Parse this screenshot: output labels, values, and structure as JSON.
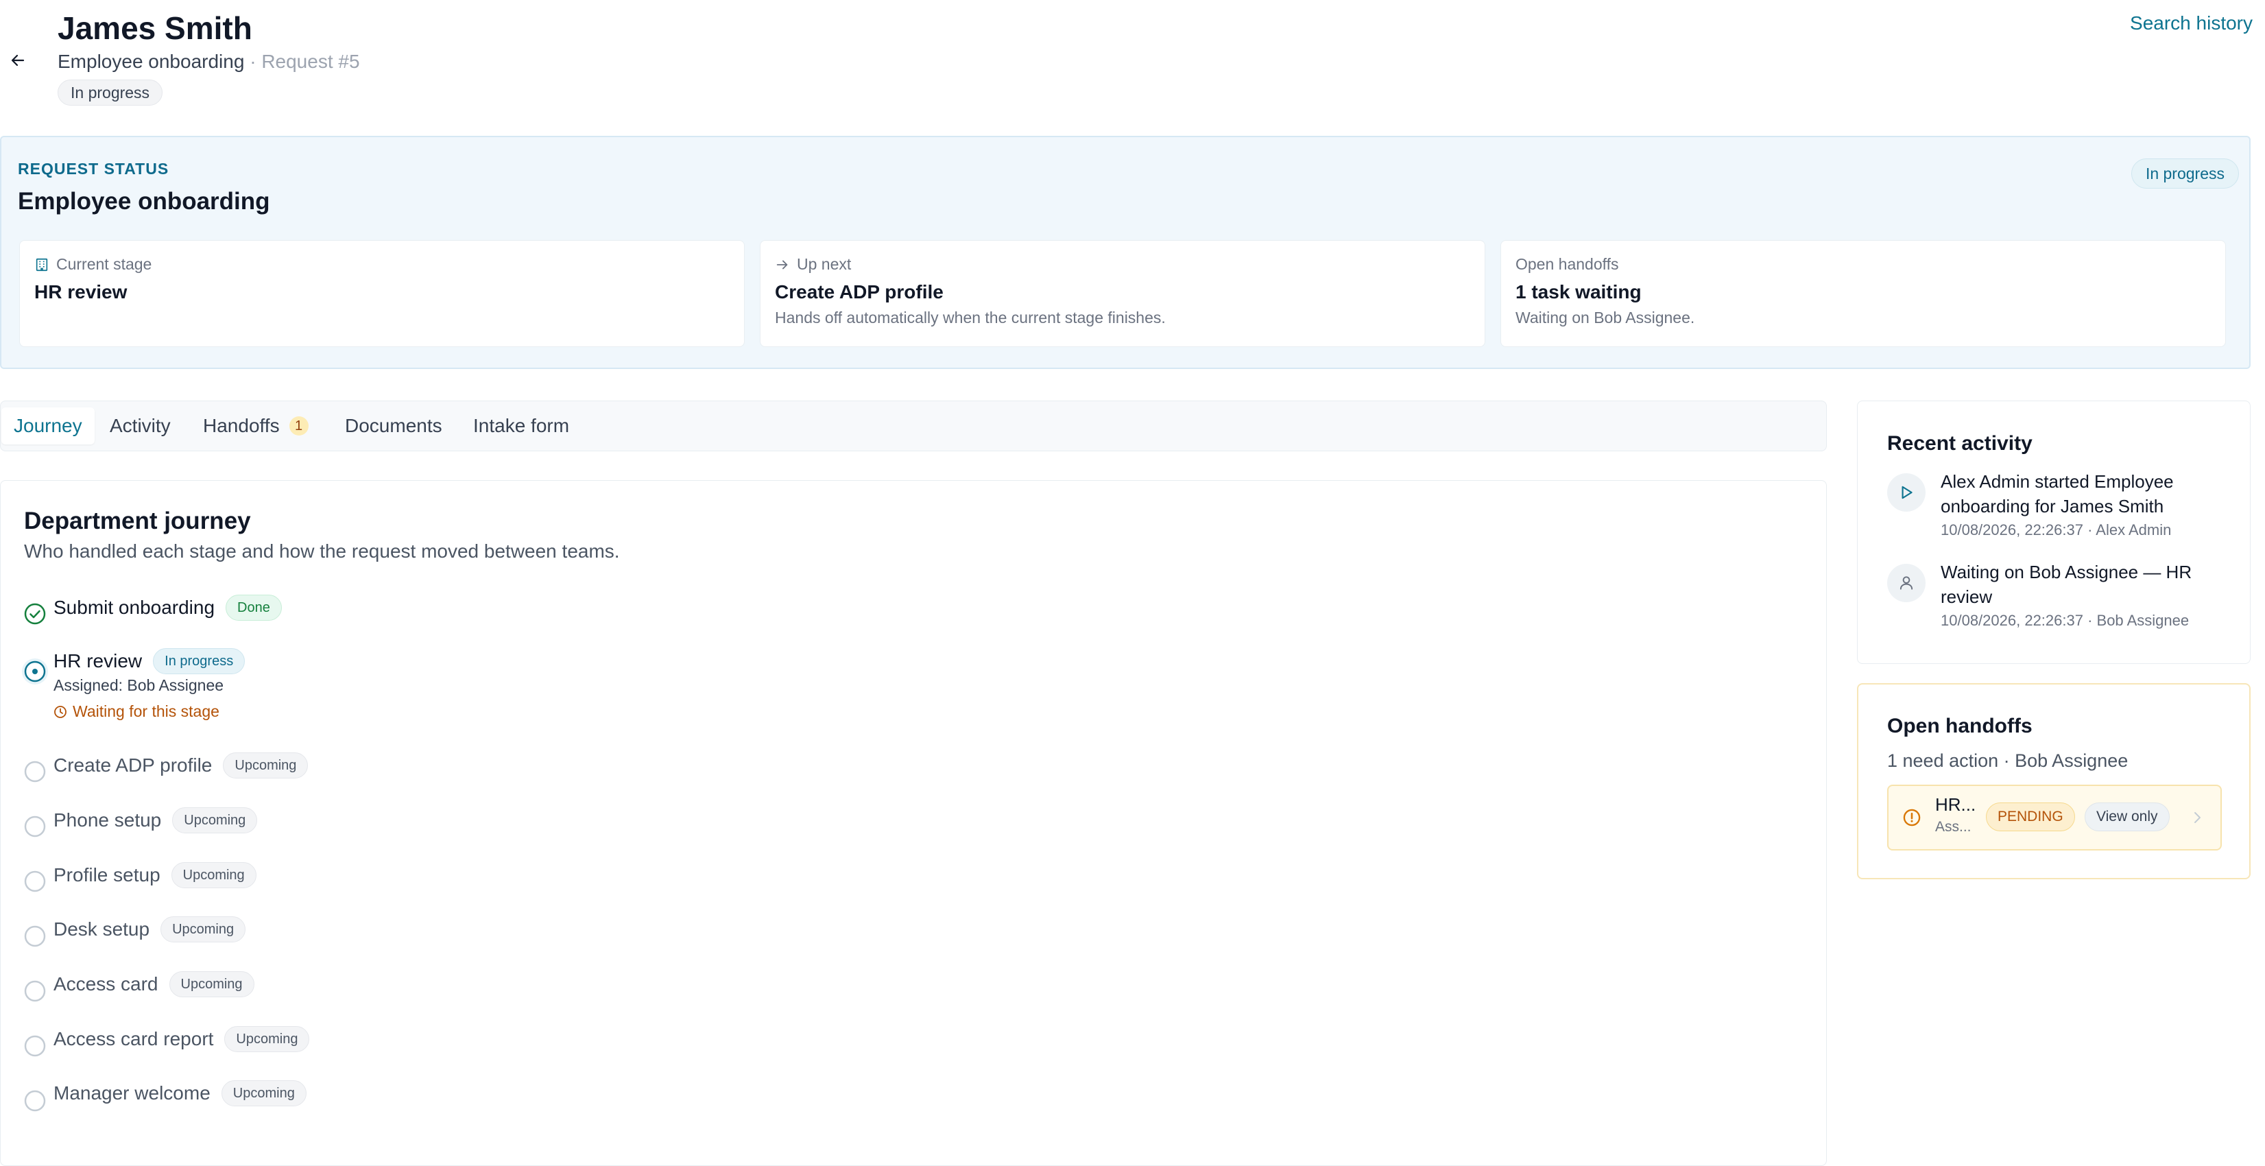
{
  "header": {
    "title": "James Smith",
    "process": "Employee onboarding",
    "separator": "·",
    "request": "Request #5",
    "status": "In progress",
    "search_history": "Search history"
  },
  "status_panel": {
    "eyebrow": "REQUEST STATUS",
    "title": "Employee onboarding",
    "status": "In progress",
    "cards": [
      {
        "label": "Current stage",
        "value": "HR review",
        "desc": "",
        "icon": "building-icon"
      },
      {
        "label": "Up next",
        "value": "Create ADP profile",
        "desc": "Hands off automatically when the current stage finishes.",
        "icon": "arrow-right-icon"
      },
      {
        "label": "Open handoffs",
        "value": "1 task waiting",
        "desc": "Waiting on Bob Assignee.",
        "icon": ""
      }
    ]
  },
  "tabs": [
    {
      "label": "Journey",
      "active": true
    },
    {
      "label": "Activity"
    },
    {
      "label": "Handoffs",
      "count": "1"
    },
    {
      "label": "Documents"
    },
    {
      "label": "Intake form"
    }
  ],
  "journey": {
    "title": "Department journey",
    "subtitle": "Who handled each stage and how the request moved between teams.",
    "steps": [
      {
        "label": "Submit onboarding",
        "badge": "Done",
        "state": "done"
      },
      {
        "label": "HR review",
        "badge": "In progress",
        "state": "progress",
        "assigned": "Assigned: Bob Assignee",
        "waiting": "Waiting for this stage"
      },
      {
        "label": "Create ADP profile",
        "badge": "Upcoming",
        "state": "upcoming"
      },
      {
        "label": "Phone setup",
        "badge": "Upcoming",
        "state": "upcoming"
      },
      {
        "label": "Profile setup",
        "badge": "Upcoming",
        "state": "upcoming"
      },
      {
        "label": "Desk setup",
        "badge": "Upcoming",
        "state": "upcoming"
      },
      {
        "label": "Access card",
        "badge": "Upcoming",
        "state": "upcoming"
      },
      {
        "label": "Access card report",
        "badge": "Upcoming",
        "state": "upcoming"
      },
      {
        "label": "Manager welcome",
        "badge": "Upcoming",
        "state": "upcoming"
      }
    ]
  },
  "recent_activity": {
    "title": "Recent activity",
    "items": [
      {
        "icon": "play-icon",
        "text": "Alex Admin started Employee onboarding for James Smith",
        "meta": "10/08/2026, 22:26:37 · Alex Admin"
      },
      {
        "icon": "user-icon",
        "text": "Waiting on Bob Assignee — HR review",
        "meta": "10/08/2026, 22:26:37 · Bob Assignee"
      }
    ]
  },
  "open_handoffs": {
    "title": "Open handoffs",
    "subtitle": "1 need action · Bob Assignee",
    "item": {
      "name": "HR...",
      "assignee": "Ass...",
      "status": "PENDING",
      "access": "View only",
      "icon": "alert-circle-icon"
    }
  },
  "colors": {
    "accent": "#0e7490",
    "done": "#15803d",
    "warning": "#b45309",
    "panel_bg": "#f0f7fc"
  }
}
